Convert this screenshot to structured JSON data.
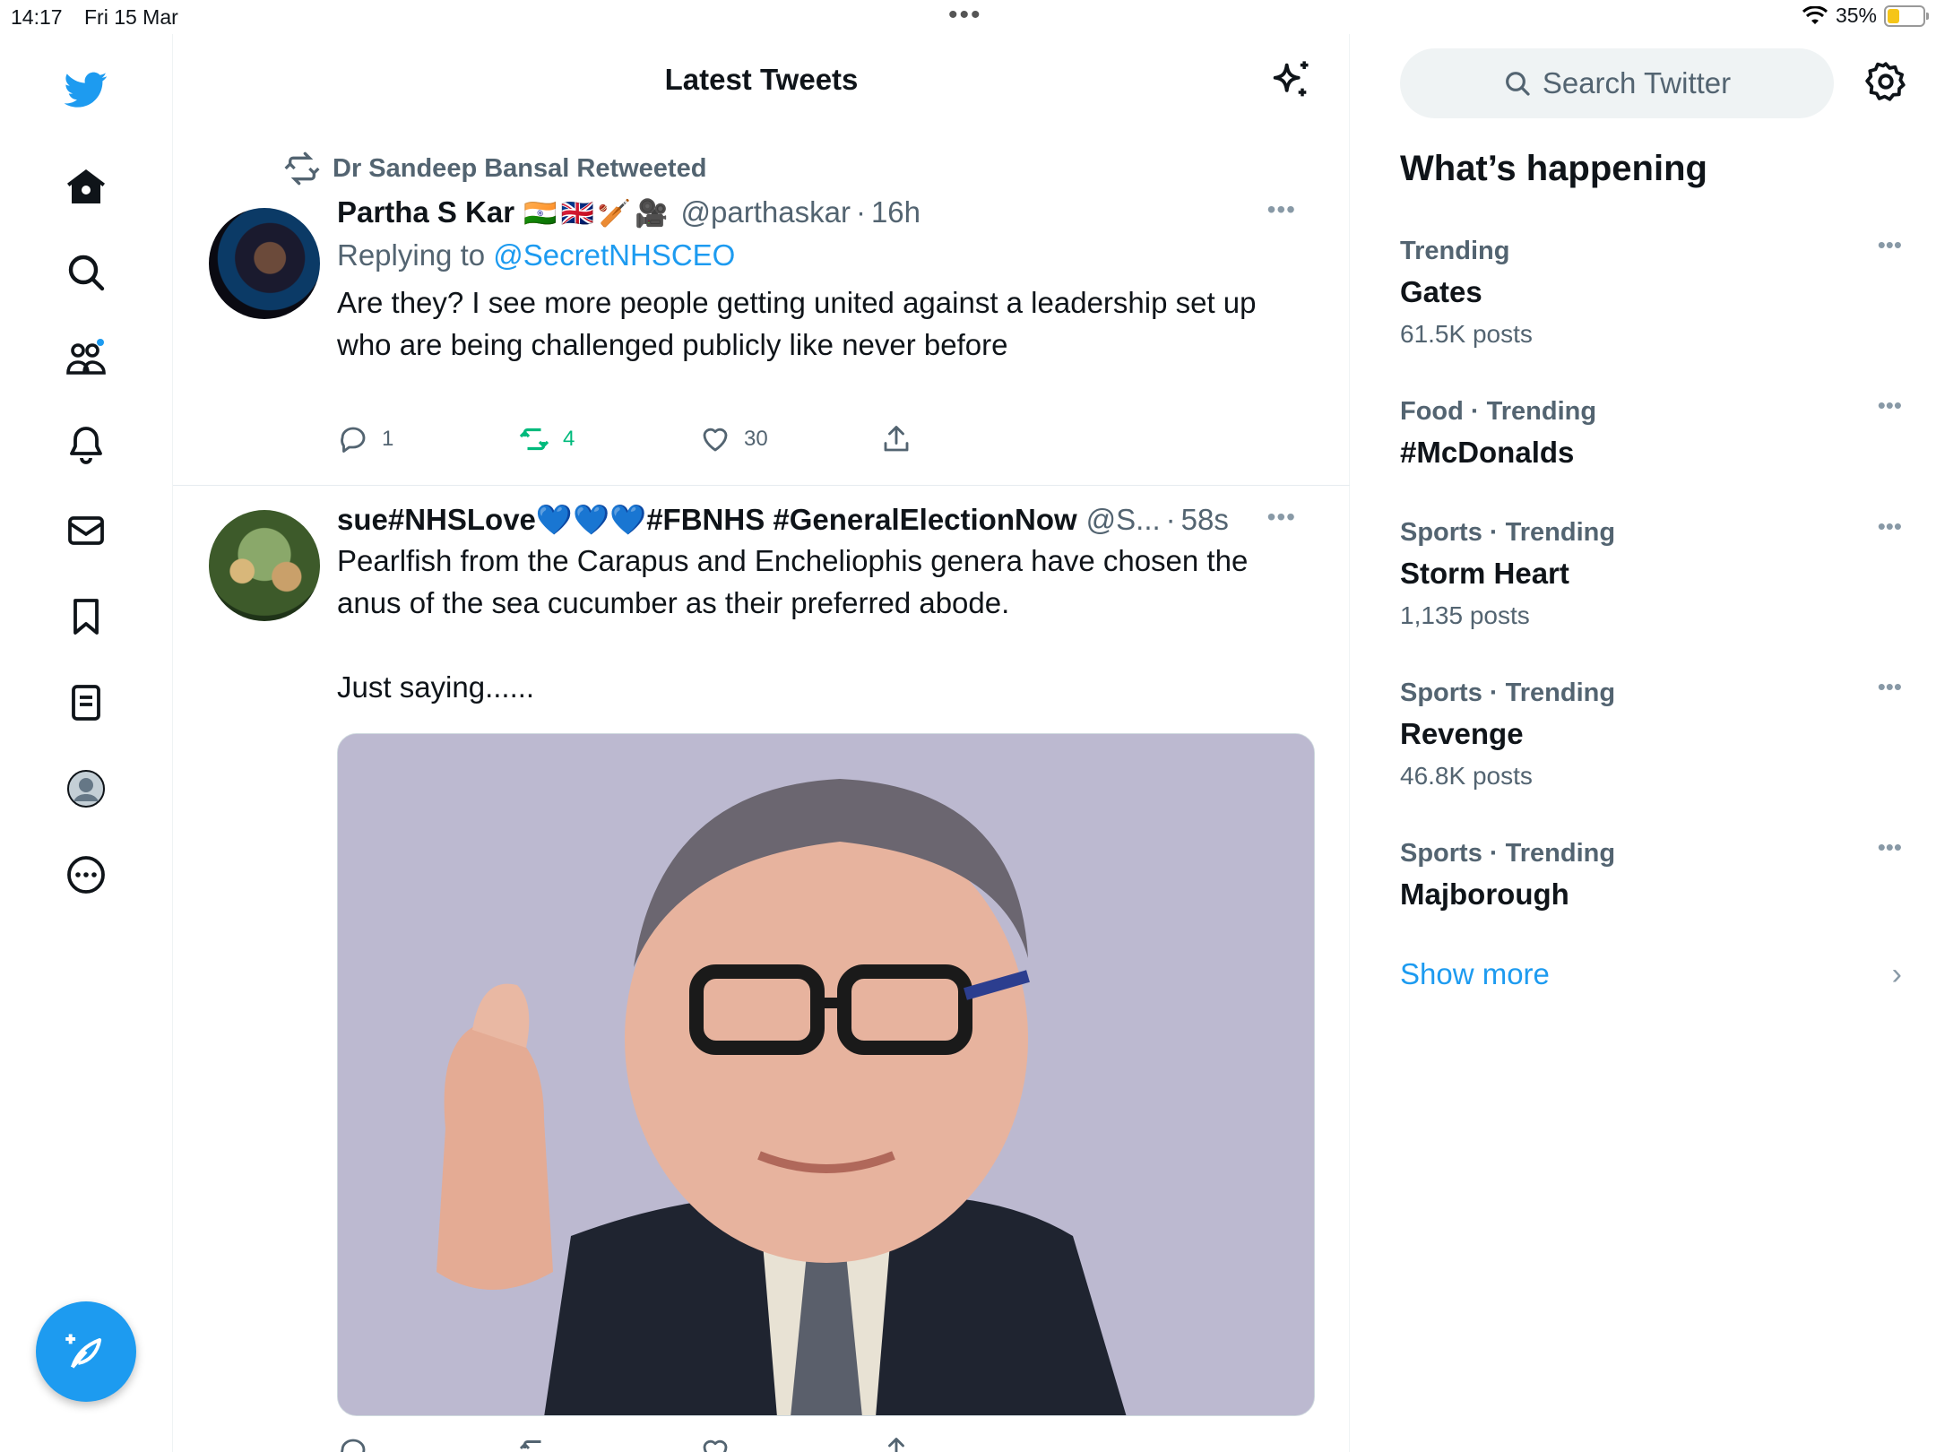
{
  "status_bar": {
    "time": "14:17",
    "date": "Fri 15 Mar",
    "battery": "35%",
    "battery_level": 0.35
  },
  "nav": {
    "items": [
      "logo",
      "home",
      "explore",
      "communities",
      "notifications",
      "messages",
      "bookmarks",
      "lists",
      "profile",
      "more"
    ],
    "compose_label": "Compose tweet"
  },
  "header": {
    "title": "Latest Tweets"
  },
  "tweets": [
    {
      "retweeted_by": "Dr Sandeep Bansal Retweeted",
      "name": "Partha S Kar",
      "name_emojis": "🇮🇳🇬🇧🏏🎥",
      "handle": "@parthaskar",
      "sep": "·",
      "time": "16h",
      "replying_prefix": "Replying to",
      "replying_to": "@SecretNHSCEO",
      "text": "Are they? I see more people getting united against a leadership set up who are being challenged publicly like never before",
      "replies": "1",
      "retweets": "4",
      "likes": "30"
    },
    {
      "name_part1": "sue#NHSLove",
      "hearts": "💙💙💙",
      "name_part2": "#FBNHS #GeneralElectionNow",
      "handle": "@S...",
      "sep": "·",
      "time": "58s",
      "text": "Pearlfish from the Carapus and Encheliophis genera have chosen the anus of the sea cucumber as their preferred abode.\n\nJust saying......",
      "replies": "",
      "retweets": "",
      "likes": ""
    }
  ],
  "sidebar": {
    "search_placeholder": "Search Twitter",
    "section_title": "What’s happening",
    "trends": [
      {
        "meta": "Trending",
        "name": "Gates",
        "count": "61.5K posts"
      },
      {
        "meta": "Food · Trending",
        "name": "#McDonalds",
        "count": ""
      },
      {
        "meta": "Sports · Trending",
        "name": "Storm Heart",
        "count": "1,135 posts"
      },
      {
        "meta": "Sports · Trending",
        "name": "Revenge",
        "count": "46.8K posts"
      },
      {
        "meta": "Sports · Trending",
        "name": "Majborough",
        "count": ""
      }
    ],
    "show_more": "Show more",
    "more_glyph": "•••",
    "chevron": "›"
  },
  "colors": {
    "accent": "#1d9bf0",
    "retweet_green": "#00ba7c",
    "muted": "#536471"
  }
}
